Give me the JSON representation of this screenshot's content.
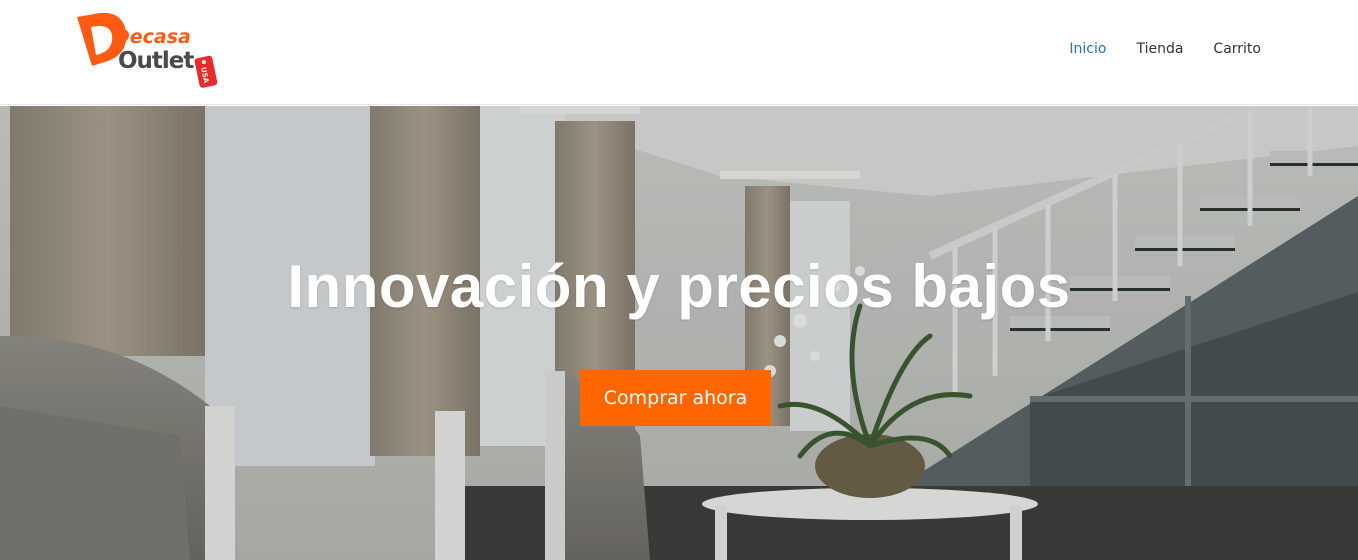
{
  "brand": {
    "logo_line1": "Decasa",
    "logo_line2": "Outlet",
    "logo_tag": "USA",
    "colors": {
      "orange": "#ff5a14",
      "red": "#ea2a2a",
      "dark": "#4a4a4a"
    }
  },
  "nav": {
    "items": [
      {
        "label": "Inicio",
        "active": true
      },
      {
        "label": "Tienda",
        "active": false
      },
      {
        "label": "Carrito",
        "active": false
      }
    ],
    "active_color": "#1e73be"
  },
  "hero": {
    "title": "Innovación y precios bajos",
    "cta_label": "Comprar ahora",
    "cta_color": "#ff6600"
  }
}
